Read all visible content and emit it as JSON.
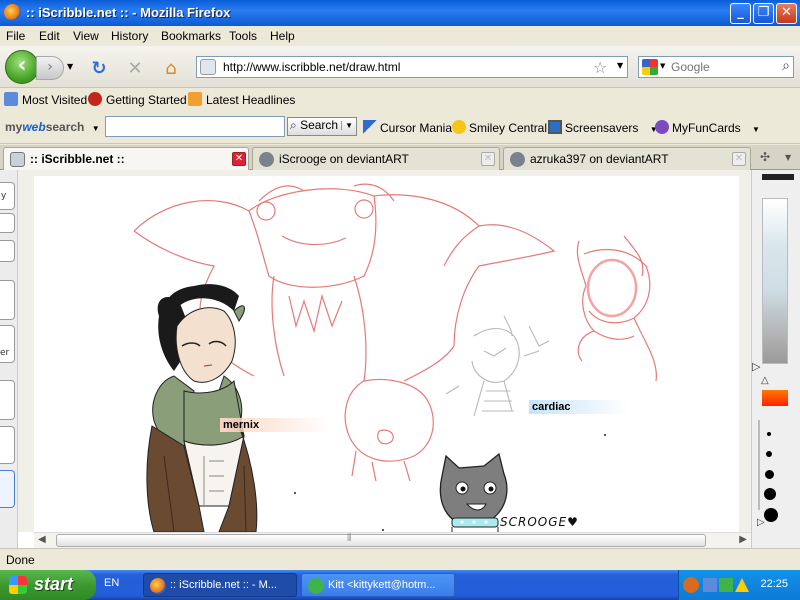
{
  "window": {
    "title": ":: iScribble.net :: - Mozilla Firefox"
  },
  "menu": [
    "File",
    "Edit",
    "View",
    "History",
    "Bookmarks",
    "Tools",
    "Help"
  ],
  "nav": {
    "url": "http://www.iscribble.net/draw.html",
    "search_placeholder": "Google"
  },
  "bookmarks": [
    "Most Visited",
    "Getting Started",
    "Latest Headlines"
  ],
  "websearch": {
    "logo_a": "my",
    "logo_b": "web",
    "logo_c": "search",
    "search_button": "Search",
    "items": [
      "Cursor Mania",
      "Smiley Central",
      "Screensavers",
      "MyFunCards"
    ]
  },
  "tabs": [
    {
      "label": ":: iScribble.net ::",
      "active": true
    },
    {
      "label": "iScrooge on deviantART",
      "active": false
    },
    {
      "label": "azruka397 on deviantART",
      "active": false
    }
  ],
  "canvas": {
    "name_tags": [
      "mernix",
      "cardiac"
    ],
    "signature": "SCROOGE♥"
  },
  "left_panel_fragments": [
    "y",
    "er"
  ],
  "status": "Done",
  "taskbar": {
    "start": "start",
    "lang": "EN",
    "items": [
      ":: iScribble.net :: - M...",
      "Kitt <kittykett@hotm..."
    ],
    "clock": "22:25"
  },
  "colors": {
    "sketch_red": "#e47a78",
    "sketch_gray": "#b8b8b8",
    "xp_blue": "#245edb"
  }
}
